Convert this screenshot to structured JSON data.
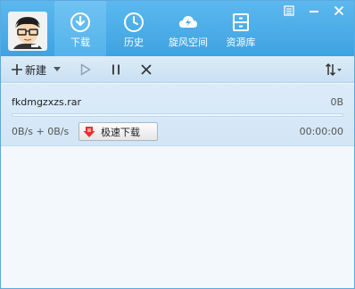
{
  "header": {
    "nav": [
      {
        "label": "下载",
        "icon": "download-icon",
        "active": true
      },
      {
        "label": "历史",
        "icon": "clock-icon",
        "active": false
      },
      {
        "label": "旋风空间",
        "icon": "cloud-icon",
        "active": false
      },
      {
        "label": "资源库",
        "icon": "cabinet-icon",
        "active": false
      }
    ],
    "window_controls": [
      "menu-icon",
      "minimize-icon",
      "close-icon"
    ]
  },
  "toolbar": {
    "new_label": "新建",
    "buttons": [
      "play-icon",
      "pause-icon",
      "delete-icon",
      "sort-icon"
    ]
  },
  "task": {
    "filename": "fkdmgzxzs.rar",
    "size": "0B",
    "progress": 0,
    "speed": "0B/s + 0B/s",
    "accel_label": "极速下载",
    "time": "00:00:00"
  },
  "colors": {
    "header": "#4aaee7",
    "accent": "#4aa7e3",
    "accel_arrow": "#e8322a"
  }
}
